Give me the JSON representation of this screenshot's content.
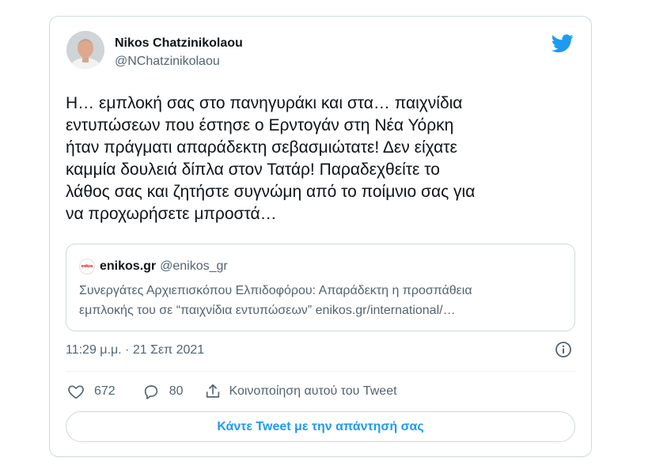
{
  "author": {
    "display_name": "Nikos Chatzinikolaou",
    "handle": "@NChatzinikolaou"
  },
  "tweet": {
    "text": "Η… εμπλοκή σας στο πανηγυράκι και στα… παιχνίδια\nεντυπώσεων που έστησε ο Ερντογάν στη Νέα Υόρκη\nήταν πράγματι απαράδεκτη σεβασμιώτατε! Δεν είχατε\nκαμμία δουλειά δίπλα στον Τατάρ! Παραδεχθείτε το\nλάθος σας και ζητήστε συγνώμη από το ποίμνιο σας για\nνα προχωρήσετε μπροστά…",
    "timestamp": "11:29 μ.μ. · 21 Σεπ 2021"
  },
  "quote": {
    "logo_text": "enikos",
    "name": "enikos.gr",
    "handle": "@enikos_gr",
    "text": "Συνεργάτες Αρχιεπισκόπου Ελπιδοφόρου: Απαράδεκτη η προσπάθεια\nεμπλοκής του σε “παιχνίδια εντυπώσεων” enikos.gr/international/…"
  },
  "actions": {
    "likes": "672",
    "replies": "80",
    "share_label": "Κοινοποίηση αυτού του Tweet"
  },
  "reply_button_label": "Κάντε Tweet με την απάντησή σας",
  "colors": {
    "accent": "#1d9bf0",
    "text_primary": "#0f1419",
    "text_secondary": "#536471",
    "border": "#cfd9de"
  },
  "icons": [
    "twitter-logo-icon",
    "info-icon",
    "heart-icon",
    "reply-icon",
    "share-icon"
  ]
}
